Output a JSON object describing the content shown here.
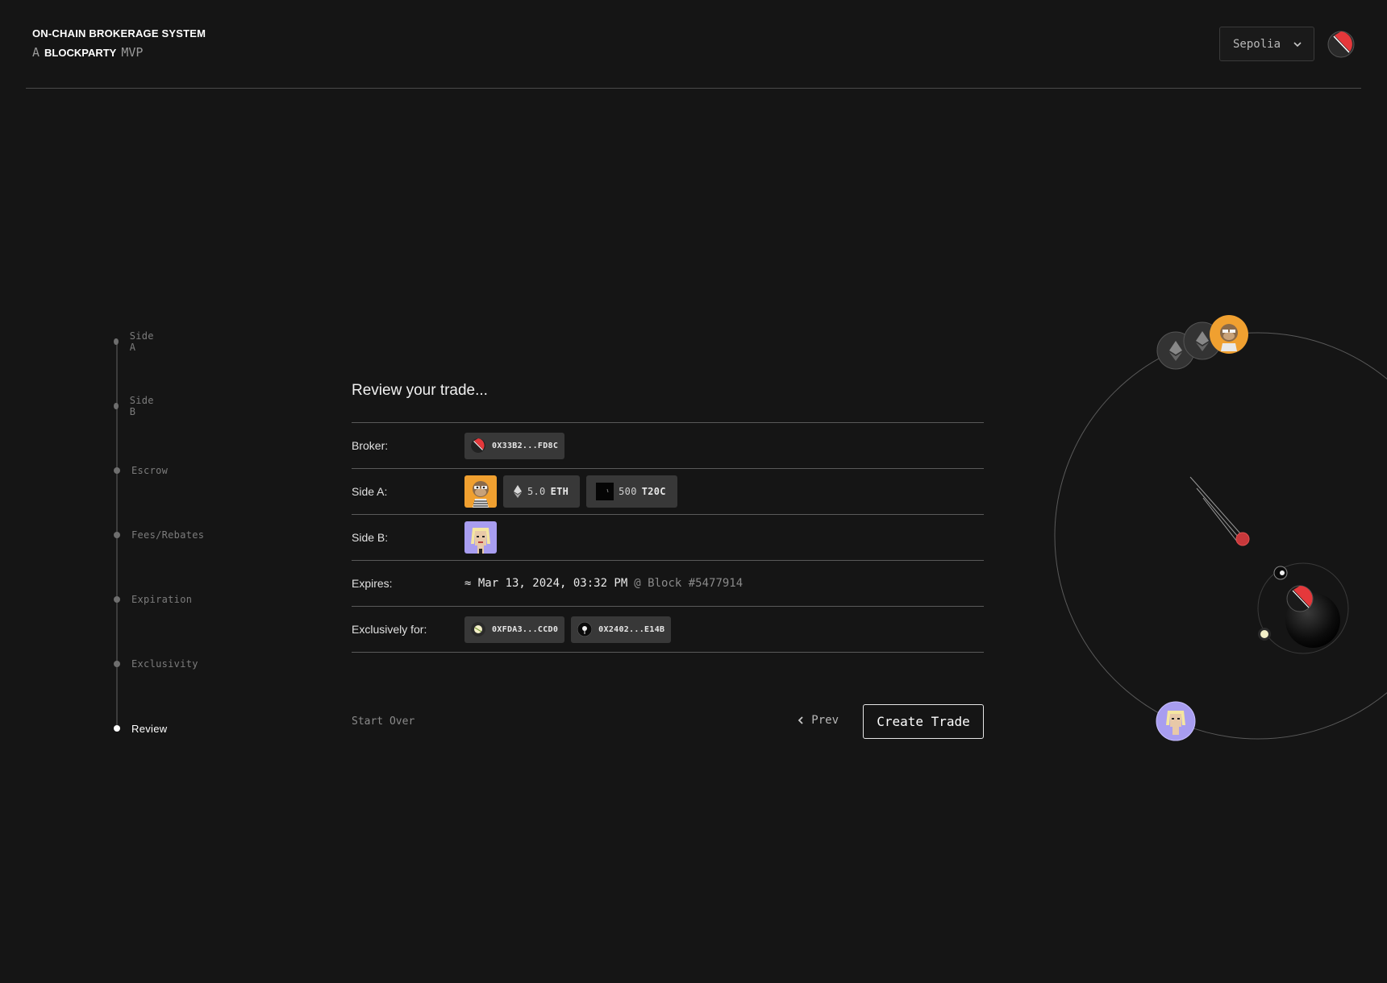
{
  "header": {
    "title": "ON-CHAIN BROKERAGE SYSTEM",
    "subtitle_prefix": "A",
    "subtitle_brand": "BLOCKPARTY",
    "subtitle_suffix": "MVP",
    "network": "Sepolia"
  },
  "steps": [
    {
      "label": "Side A"
    },
    {
      "label": "Side B"
    },
    {
      "label": "Escrow"
    },
    {
      "label": "Fees/Rebates"
    },
    {
      "label": "Expiration"
    },
    {
      "label": "Exclusivity"
    },
    {
      "label": "Review",
      "active": true
    }
  ],
  "review": {
    "title": "Review your trade...",
    "broker_label": "Broker:",
    "broker_address": "0X33B2...FD8C",
    "side_a_label": "Side A:",
    "side_a_tokens": [
      {
        "amount": "5.0",
        "symbol": "ETH"
      },
      {
        "amount": "500",
        "symbol": "T20C"
      }
    ],
    "side_b_label": "Side B:",
    "expires_label": "Expires:",
    "expires_value": "≈ Mar 13, 2024, 03:32 PM",
    "expires_block": "@ Block #5477914",
    "exclusive_label": "Exclusively for:",
    "exclusive_addresses": [
      "0XFDA3...CCD0",
      "0X2402...E14B"
    ]
  },
  "actions": {
    "start_over": "Start Over",
    "prev": "Prev",
    "create": "Create Trade"
  },
  "colors": {
    "background": "#151515",
    "accent_red": "#e5383b",
    "ape_orange": "#f0a030",
    "punk_purple": "#a89df0"
  }
}
